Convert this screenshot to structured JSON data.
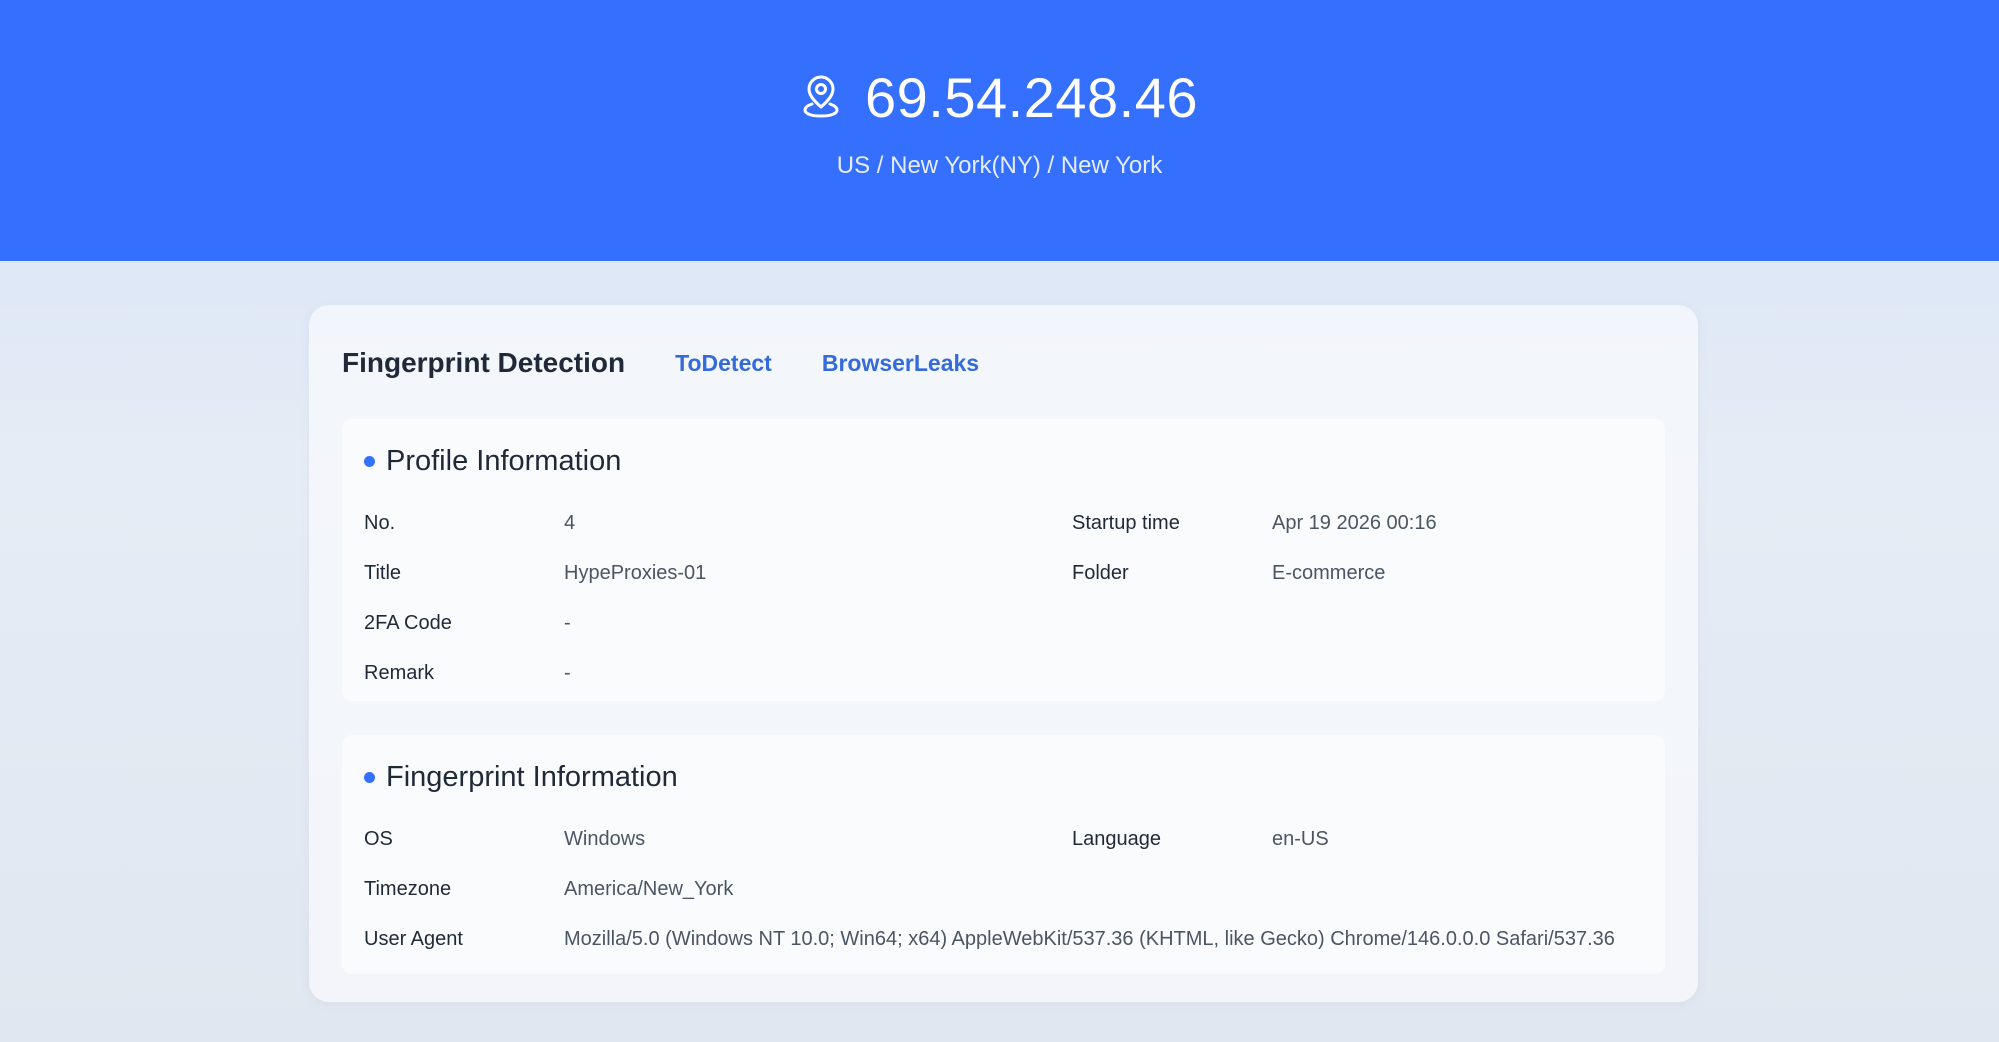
{
  "header": {
    "ip": "69.54.248.46",
    "location": "US / New York(NY) / New York",
    "icon": "location-pin-icon",
    "bg_color": "#356ffe"
  },
  "card": {
    "title": "Fingerprint Detection",
    "links": [
      "ToDetect",
      "BrowserLeaks"
    ],
    "accent_color": "#356ad9"
  },
  "profile": {
    "title": "Profile Information",
    "fields": {
      "no": {
        "label": "No.",
        "value": "4"
      },
      "startup_time": {
        "label": "Startup time",
        "value": "Apr 19 2026 00:16"
      },
      "title": {
        "label": "Title",
        "value": "HypeProxies-01"
      },
      "folder": {
        "label": "Folder",
        "value": "E-commerce"
      },
      "twofa": {
        "label": "2FA Code",
        "value": "-"
      },
      "remark": {
        "label": "Remark",
        "value": "-"
      }
    }
  },
  "fingerprint": {
    "title": "Fingerprint Information",
    "fields": {
      "os": {
        "label": "OS",
        "value": "Windows"
      },
      "language": {
        "label": "Language",
        "value": "en-US"
      },
      "timezone": {
        "label": "Timezone",
        "value": "America/New_York"
      },
      "user_agent": {
        "label": "User Agent",
        "value": "Mozilla/5.0 (Windows NT 10.0; Win64; x64) AppleWebKit/537.36 (KHTML, like Gecko) Chrome/146.0.0.0 Safari/537.36"
      }
    }
  }
}
